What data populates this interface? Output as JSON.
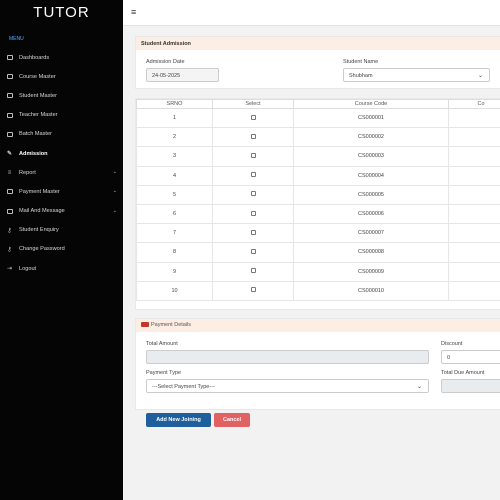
{
  "app": {
    "logo": "TUTOR",
    "menu_heading": "MENU"
  },
  "sidebar": {
    "items": [
      {
        "label": "Dashboards",
        "icon": "dashboard-icon",
        "chevron": false,
        "active": false
      },
      {
        "label": "Course Master",
        "icon": "book-icon",
        "chevron": false,
        "active": false
      },
      {
        "label": "Student Master",
        "icon": "student-icon",
        "chevron": false,
        "active": false
      },
      {
        "label": "Teacher Master",
        "icon": "teacher-icon",
        "chevron": false,
        "active": false
      },
      {
        "label": "Batch Master",
        "icon": "batch-icon",
        "chevron": false,
        "active": false
      },
      {
        "label": "Admission",
        "icon": "pencil-icon",
        "chevron": false,
        "active": true
      },
      {
        "label": "Report",
        "icon": "report-icon",
        "chevron": true,
        "active": false
      },
      {
        "label": "Payment Master",
        "icon": "payment-icon",
        "chevron": true,
        "active": false
      },
      {
        "label": "Mail And Message",
        "icon": "mail-icon",
        "chevron": true,
        "active": false
      },
      {
        "label": "Student Enquiry",
        "icon": "key-icon",
        "chevron": false,
        "active": false
      },
      {
        "label": "Change Password",
        "icon": "key-icon",
        "chevron": false,
        "active": false
      },
      {
        "label": "Logout",
        "icon": "logout-icon",
        "chevron": false,
        "active": false
      }
    ]
  },
  "admission": {
    "title": "Student Admission",
    "date_label": "Admission Date",
    "date_value": "24-05-2025",
    "student_label": "Student Name",
    "student_value": "Shubham"
  },
  "table": {
    "headers": [
      "SRNO",
      "Select",
      "Course Code",
      "Co"
    ],
    "rows": [
      {
        "srno": "1",
        "code": "CS000001",
        "extra": ""
      },
      {
        "srno": "2",
        "code": "CS000002",
        "extra": "AS"
      },
      {
        "srno": "3",
        "code": "CS000003",
        "extra": ""
      },
      {
        "srno": "4",
        "code": "CS000004",
        "extra": "A"
      },
      {
        "srno": "5",
        "code": "CS000005",
        "extra": ""
      },
      {
        "srno": "6",
        "code": "CS000006",
        "extra": ""
      },
      {
        "srno": "7",
        "code": "CS000007",
        "extra": ""
      },
      {
        "srno": "8",
        "code": "CS000008",
        "extra": "A"
      },
      {
        "srno": "9",
        "code": "CS000009",
        "extra": ""
      },
      {
        "srno": "10",
        "code": "CS000010",
        "extra": ""
      }
    ]
  },
  "payment": {
    "title": "Payment Details",
    "total_label": "Total Amount",
    "total_value": "",
    "discount_label": "Discount",
    "discount_value": "0",
    "type_label": "Payment Type",
    "type_value": "---Select Payment Type---",
    "due_label": "Total Due Amount",
    "due_value": ""
  },
  "actions": {
    "add_label": "Add New Joining",
    "cancel_label": "Cancel"
  },
  "colors": {
    "sidebar_bg": "#050505",
    "menu_heading": "#5aa9ff",
    "card_header": "#fdeee4",
    "primary": "#1f5f9e",
    "danger": "#e06262"
  }
}
